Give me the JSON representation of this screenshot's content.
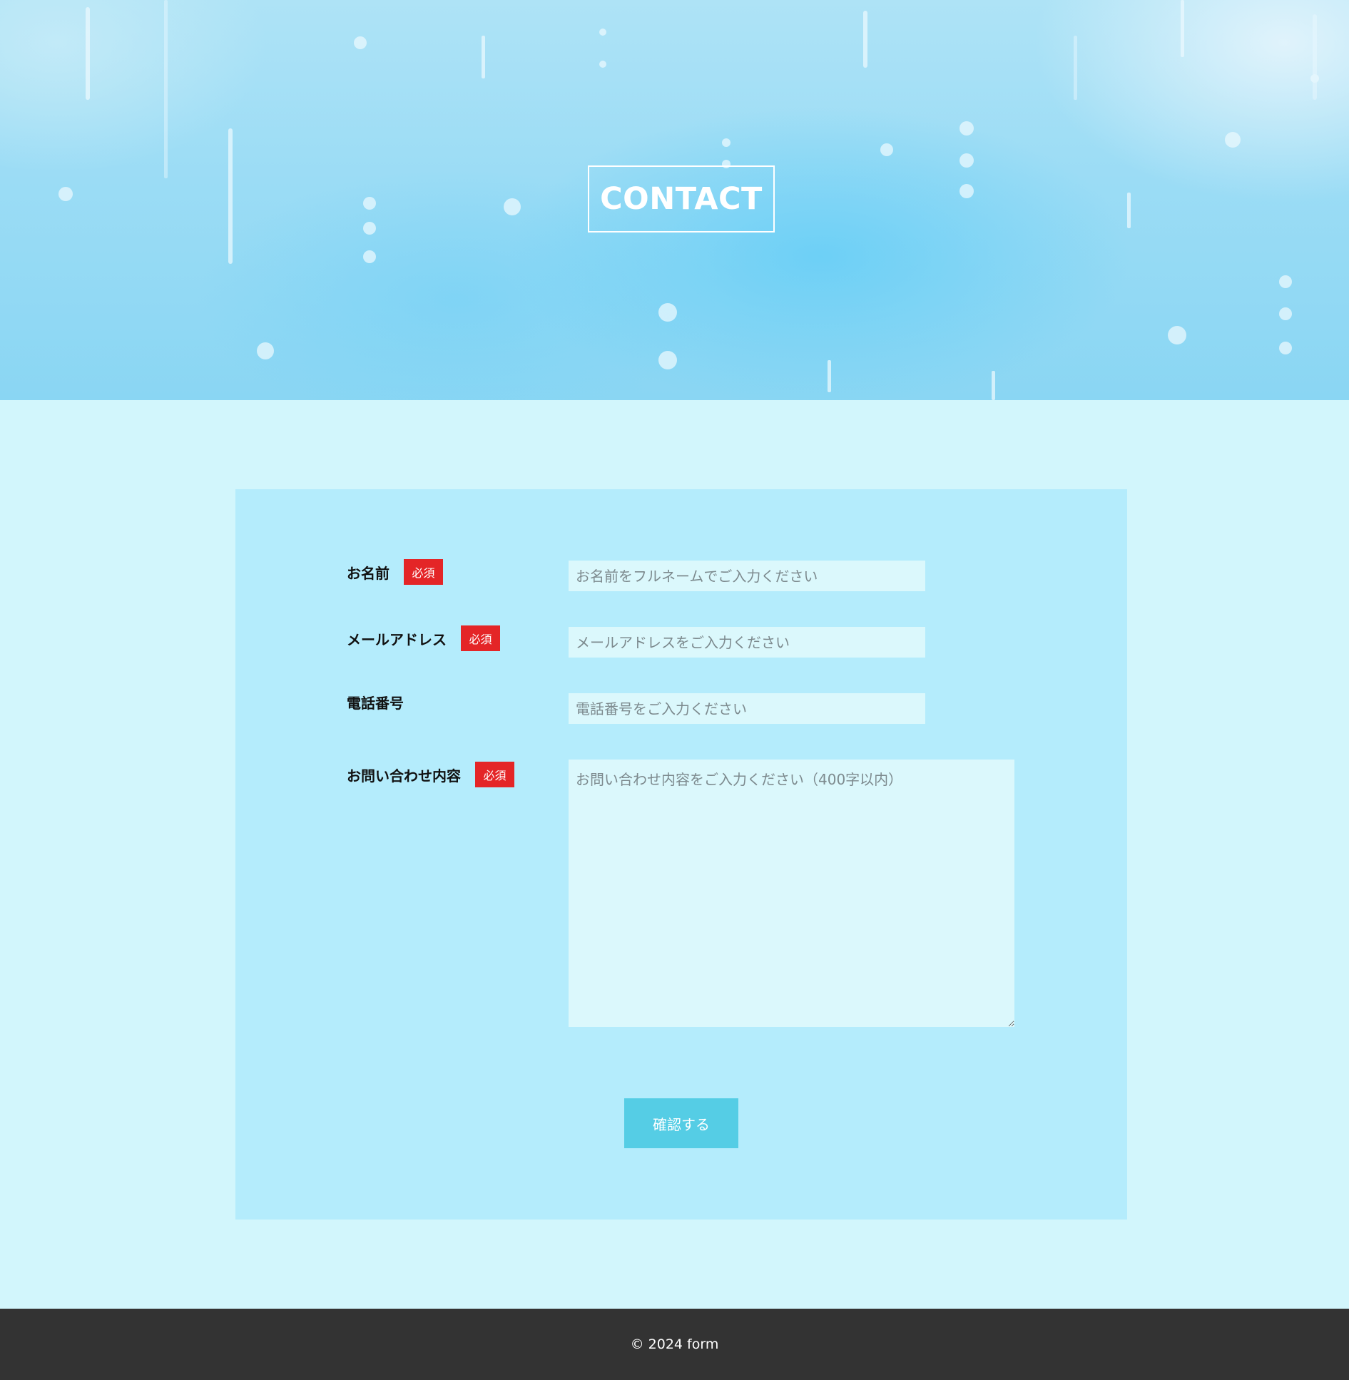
{
  "hero": {
    "title": "CONTACT"
  },
  "form": {
    "required_badge": "必須",
    "fields": {
      "name": {
        "label": "お名前",
        "placeholder": "お名前をフルネームでご入力ください"
      },
      "email": {
        "label": "メールアドレス",
        "placeholder": "メールアドレスをご入力ください"
      },
      "phone": {
        "label": "電話番号",
        "placeholder": "電話番号をご入力ください"
      },
      "message": {
        "label": "お問い合わせ内容",
        "placeholder": "お問い合わせ内容をご入力ください（400字以内）"
      }
    },
    "submit_label": "確認する"
  },
  "footer": {
    "copyright": "© 2024 form"
  },
  "colors": {
    "page_background": "#d2f6fc",
    "card_background": "#b4ecfc",
    "field_background": "#dbf8fc",
    "required_badge": "#e42527",
    "submit_button": "#55cde5",
    "footer_background": "#333333"
  }
}
